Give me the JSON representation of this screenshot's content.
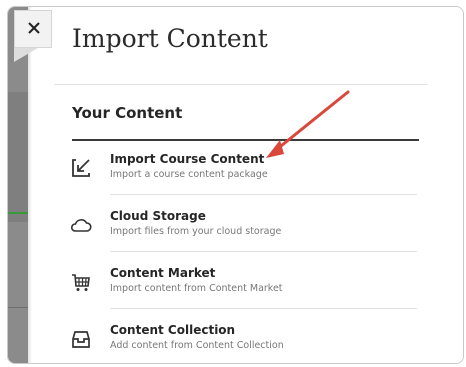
{
  "dialog": {
    "title": "Import Content",
    "close_symbol": "×"
  },
  "section": {
    "title": "Your Content"
  },
  "items": [
    {
      "label": "Import Course Content",
      "description": "Import a course content package",
      "icon": "import-arrow-icon"
    },
    {
      "label": "Cloud Storage",
      "description": "Import files from your cloud storage",
      "icon": "cloud-icon"
    },
    {
      "label": "Content Market",
      "description": "Import content from Content Market",
      "icon": "cart-icon"
    },
    {
      "label": "Content Collection",
      "description": "Add content from Content Collection",
      "icon": "collection-tray-icon"
    }
  ],
  "colors": {
    "annotation_arrow": "#d9483b",
    "text_primary": "#262626",
    "text_secondary": "#777777",
    "backdrop": "#8b8b8b"
  }
}
